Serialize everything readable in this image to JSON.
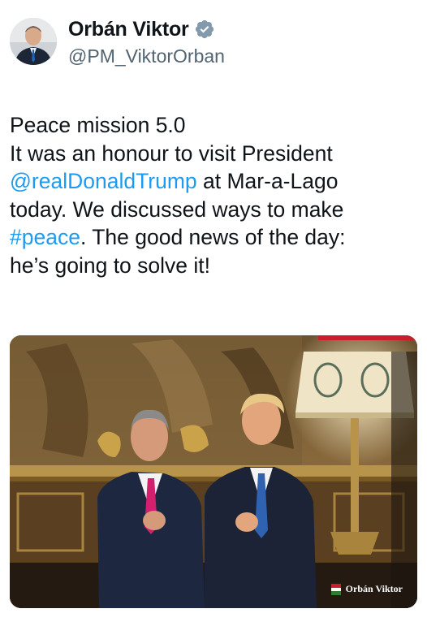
{
  "author": {
    "display_name": "Orbán Viktor",
    "handle": "@PM_ViktorOrban",
    "avatar_icon": "profile-photo",
    "verified_icon": "verified-badge-icon",
    "verified_color": "#829aab"
  },
  "tweet": {
    "lines": [
      [
        {
          "t": "Peace mission 5.0"
        }
      ],
      [
        {
          "t": "It was an honour to visit President"
        }
      ],
      [
        {
          "t": "@realDonaldTrump",
          "link": true
        },
        {
          "t": " at Mar-a-Lago"
        }
      ],
      [
        {
          "t": "today. We discussed ways to make"
        }
      ],
      [
        {
          "t": "#peace",
          "link": true
        },
        {
          "t": ". The good news of the day:"
        }
      ],
      [
        {
          "t": "he’s going to solve it!"
        }
      ]
    ],
    "link_color": "#1d9bf0"
  },
  "media": {
    "watermark": "Orbán Viktor"
  }
}
